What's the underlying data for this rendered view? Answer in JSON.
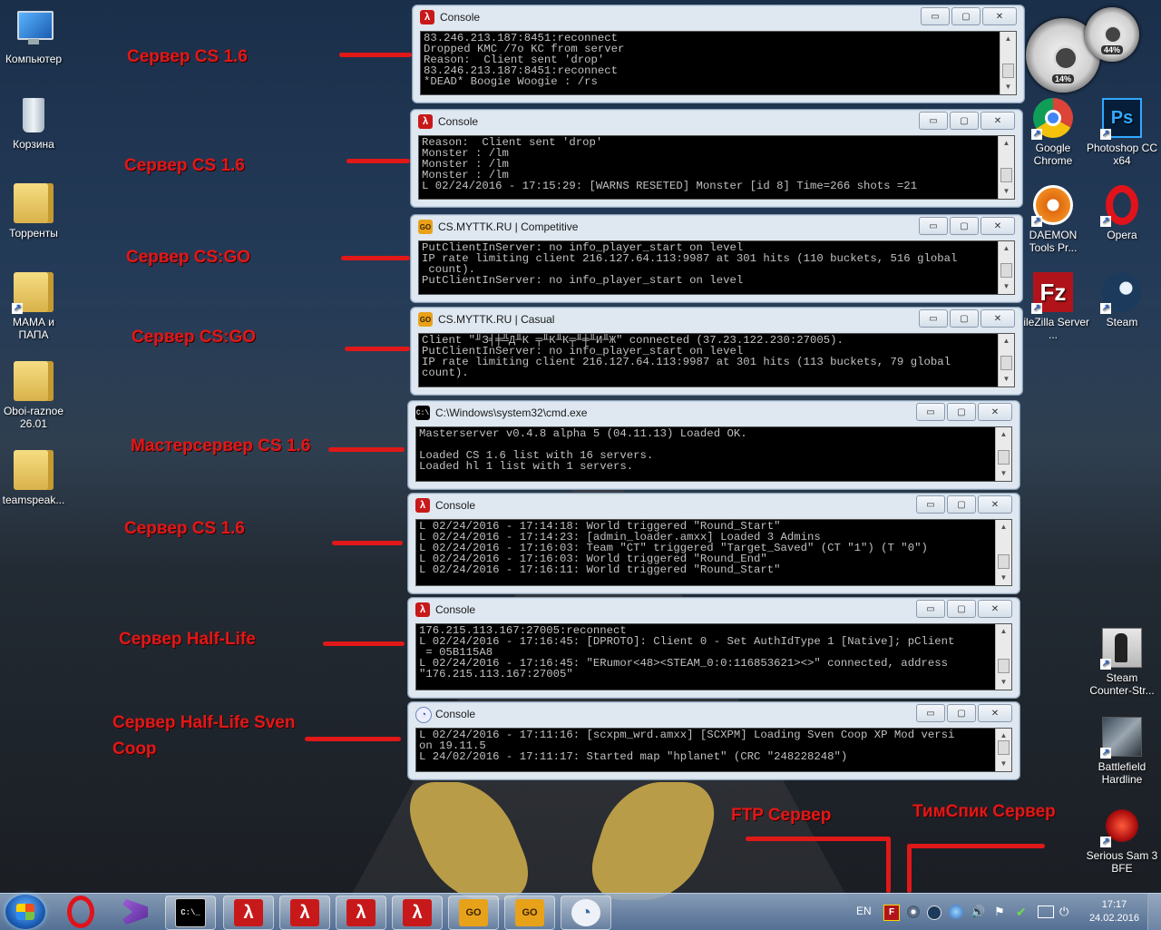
{
  "desktop_left": [
    {
      "label": "Компьютер",
      "icon": "computer-icon"
    },
    {
      "label": "Корзина",
      "icon": "recycle-bin-icon"
    },
    {
      "label": "Торренты",
      "icon": "folder-icon"
    },
    {
      "label": "МАМА и ПАПА",
      "icon": "folder-icon"
    },
    {
      "label": "Oboi-raznoe 26.01",
      "icon": "folder-icon"
    },
    {
      "label": "teamspeak...",
      "icon": "folder-icon"
    }
  ],
  "desktop_right": [
    {
      "label": "Google Chrome",
      "icon": "chrome-icon"
    },
    {
      "label": "Photoshop CC x64",
      "icon": "photoshop-icon"
    },
    {
      "label": "DAEMON Tools Pr...",
      "icon": "daemon-tools-icon"
    },
    {
      "label": "Opera",
      "icon": "opera-icon"
    },
    {
      "label": "FileZilla Server ...",
      "icon": "filezilla-icon"
    },
    {
      "label": "Steam",
      "icon": "steam-icon"
    },
    {
      "label": "Steam Counter-Str...",
      "icon": "counter-strike-icon"
    },
    {
      "label": "Battlefield Hardline",
      "icon": "battlefield-icon"
    },
    {
      "label": "Serious Sam 3 BFE",
      "icon": "serious-sam-icon"
    }
  ],
  "gadget": {
    "cpu": "14%",
    "mem": "44%"
  },
  "annotations": [
    "Сервер CS 1.6",
    "Сервер CS 1.6",
    "Сервер CS:GO",
    "Сервер CS:GO",
    "Мастерсервер CS 1.6",
    "Сервер CS 1.6",
    "Сервер Half-Life",
    "Сервер Half-Life Sven Coop",
    "FTP Сервер",
    "ТимСпик Сервер"
  ],
  "windows": [
    {
      "title": "Console",
      "icon": "half-life-icon",
      "lines": "83.246.213.187:8451:reconnect\nDropped KMC /7o KC from server\nReason:  Client sent 'drop'\n83.246.213.187:8451:reconnect\n*DEAD* Boogie Woogie : /rs"
    },
    {
      "title": "Console",
      "icon": "half-life-icon",
      "lines": "Reason:  Client sent 'drop'\nMonster : /lm\nMonster : /lm\nMonster : /lm\nL 02/24/2016 - 17:15:29: [WARNS RESETED] Monster [id 8] Time=266 shots =21"
    },
    {
      "title": "CS.MYTTK.RU | Competitive",
      "icon": "csgo-icon",
      "lines": "PutClientInServer: no info_player_start on level\nIP rate limiting client 216.127.64.113:9987 at 301 hits (110 buckets, 516 global\n count).\nPutClientInServer: no info_player_start on level"
    },
    {
      "title": "CS.MYTTK.RU | Casual",
      "icon": "csgo-icon",
      "lines": "Client \"╜З╡╪╩Д╨К ╤╨К╨К╤╨╪╨И╨Ж\" connected (37.23.122.230:27005).\nPutClientInServer: no info_player_start on level\nIP rate limiting client 216.127.64.113:9987 at 301 hits (113 buckets, 79 global\ncount)."
    },
    {
      "title": "C:\\Windows\\system32\\cmd.exe",
      "icon": "cmd-icon",
      "lines": "Masterserver v0.4.8 alpha 5 (04.11.13) Loaded OK.\n\nLoaded CS 1.6 list with 16 servers.\nLoaded hl 1 list with 1 servers."
    },
    {
      "title": "Console",
      "icon": "half-life-icon",
      "lines": "L 02/24/2016 - 17:14:18: World triggered \"Round_Start\"\nL 02/24/2016 - 17:14:23: [admin_loader.amxx] Loaded 3 Admins\nL 02/24/2016 - 17:16:03: Team \"CT\" triggered \"Target_Saved\" (CT \"1\") (T \"0\")\nL 02/24/2016 - 17:16:03: World triggered \"Round_End\"\nL 02/24/2016 - 17:16:11: World triggered \"Round_Start\""
    },
    {
      "title": "Console",
      "icon": "half-life-icon",
      "lines": "176.215.113.167:27005:reconnect\nL 02/24/2016 - 17:16:45: [DPROTO]: Client 0 - Set AuthIdType 1 [Native]; pClient\n = 05B115A8\nL 02/24/2016 - 17:16:45: \"ERumor<48><STEAM_0:0:116853621><>\" connected, address\n\"176.215.113.167:27005\""
    },
    {
      "title": "Console",
      "icon": "sven-coop-icon",
      "lines": "L 02/24/2016 - 17:11:16: [scxpm_wrd.amxx] [SCXPM] Loading Sven Coop XP Mod versi\non 19.11.5\nL 24/02/2016 - 17:11:17: Started map \"hplanet\" (CRC \"248228248\")"
    }
  ],
  "window_buttons": {
    "minimize": "▭",
    "maximize": "▢",
    "close": "✕"
  },
  "taskbar": {
    "items": [
      "opera-icon",
      "visual-studio-icon",
      "cmd-icon",
      "half-life-icon",
      "half-life-icon",
      "half-life-icon",
      "half-life-icon",
      "csgo-icon",
      "csgo-icon",
      "sven-coop-icon"
    ],
    "csgo_label": "GO",
    "cmd_label": "C:\\_",
    "lang": "EN",
    "time": "17:17",
    "date": "24.02.2016"
  }
}
